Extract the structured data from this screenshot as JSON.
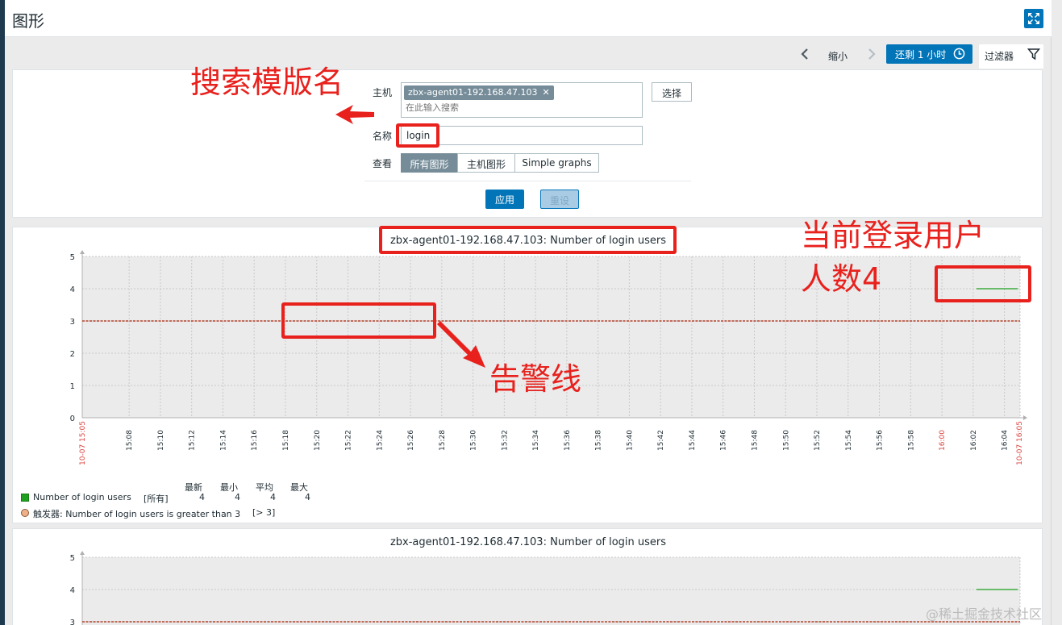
{
  "page": {
    "title": "图形"
  },
  "timebar": {
    "zoom_out": "缩小",
    "period": "还剩 1 小时",
    "filter": "过滤器"
  },
  "filter": {
    "host_label": "主机",
    "host_chip": "zbx-agent01-192.168.47.103",
    "host_placeholder": "在此输入搜索",
    "select_button": "选择",
    "name_label": "名称",
    "name_value": "login",
    "view_label": "查看",
    "view_options": [
      "所有图形",
      "主机图形",
      "Simple graphs"
    ],
    "view_selected": "所有图形",
    "apply": "应用",
    "reset": "重设"
  },
  "chart_data": [
    {
      "type": "line",
      "title": "zbx-agent01-192.168.47.103: Number of login users",
      "ylim": [
        0,
        5
      ],
      "y_ticks": [
        "0",
        "1",
        "2",
        "3",
        "4",
        "5"
      ],
      "x_start": "10-07 15:05",
      "x_end": "10-07 16:05",
      "x_ticks": [
        "15:08",
        "15:10",
        "15:12",
        "15:14",
        "15:16",
        "15:18",
        "15:20",
        "15:22",
        "15:24",
        "15:26",
        "15:28",
        "15:30",
        "15:32",
        "15:34",
        "15:36",
        "15:38",
        "15:40",
        "15:42",
        "15:44",
        "15:46",
        "15:48",
        "15:50",
        "15:52",
        "15:54",
        "15:56",
        "15:58",
        "16:00",
        "16:02",
        "16:04"
      ],
      "grid": true,
      "series": [
        {
          "name": "Number of login users",
          "color": "#1a9e1a",
          "x_range": [
            "16:02",
            "16:05"
          ],
          "values": [
            4,
            4
          ]
        }
      ],
      "trigger": {
        "name": "触发器: Number of login users is greater than 3",
        "condition": "[> 3]",
        "value": 3,
        "color": "#b5432c"
      },
      "legend": {
        "headers": [
          "最新",
          "最小",
          "平均",
          "最大"
        ],
        "rows": [
          {
            "color": "#1fa01f",
            "name": "Number of login users",
            "func": "[所有]",
            "values": [
              "4",
              "4",
              "4",
              "4"
            ]
          }
        ],
        "trigger_row": {
          "color": "#f0b18a",
          "text": "触发器: Number of login users is greater than 3",
          "condition": "[> 3]"
        }
      }
    },
    {
      "type": "line",
      "title": "zbx-agent01-192.168.47.103: Number of login users",
      "ylim": [
        0,
        5
      ],
      "y_ticks": [
        "3",
        "4",
        "5"
      ],
      "grid": true,
      "series": [
        {
          "name": "Number of login users",
          "color": "#1a9e1a",
          "values": [
            4,
            4
          ]
        }
      ],
      "trigger": {
        "value": 3,
        "color": "#b5432c"
      }
    }
  ],
  "annotations": {
    "search_template": "搜索模版名",
    "current_users": [
      "当前登录用户",
      "人数4"
    ],
    "alarm_line": "告警线",
    "color": "#e8211d"
  },
  "watermark": "@稀土掘金技术社区"
}
